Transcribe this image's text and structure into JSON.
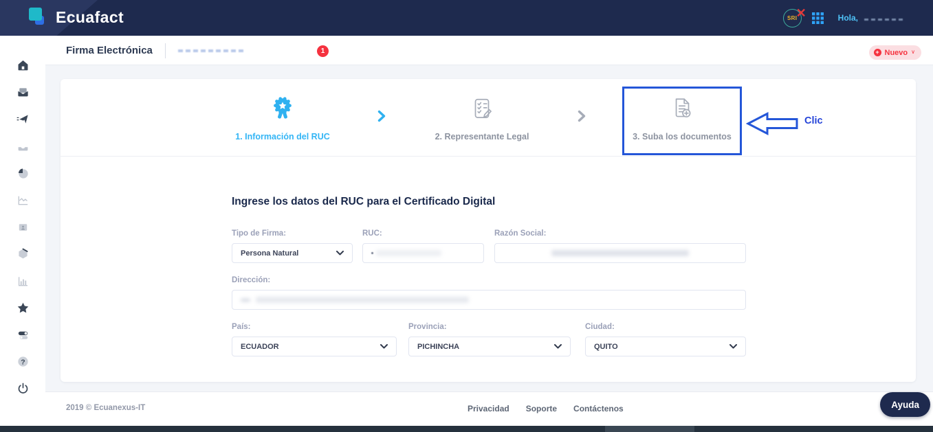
{
  "navbar": {
    "brand": "Ecuafact",
    "sri_label": "SRI",
    "greeting": "Hola,"
  },
  "breadcrumb": {
    "title": "Firma Electrónica",
    "badge_count": "1"
  },
  "toolbar": {
    "new_label": "Nuevo"
  },
  "sidebar": {
    "icons": [
      "home-icon",
      "mail-icon",
      "send-icon",
      "inbox-icon",
      "pie-chart-icon",
      "line-chart-icon",
      "folder-user-icon",
      "hexagon-icon",
      "bar-chart-icon",
      "star-icon",
      "toggles-icon",
      "help-icon",
      "power-icon"
    ]
  },
  "stepper": {
    "steps": [
      {
        "label": "1. Información del RUC",
        "state": "active"
      },
      {
        "label": "2. Representante Legal",
        "state": "idle"
      },
      {
        "label": "3. Suba los documentos",
        "state": "highlighted"
      }
    ],
    "annotation_text": "Clic"
  },
  "form": {
    "heading": "Ingrese los datos del RUC para el Certificado Digital",
    "fields": {
      "tipo_de_firma": {
        "label": "Tipo de Firma:",
        "value": "Persona Natural"
      },
      "ruc": {
        "label": "RUC:",
        "value": ""
      },
      "razon_social": {
        "label": "Razón Social:",
        "value": ""
      },
      "direccion": {
        "label": "Dirección:",
        "value": ""
      },
      "pais": {
        "label": "País:",
        "value": "ECUADOR"
      },
      "provincia": {
        "label": "Provincia:",
        "value": "PICHINCHA"
      },
      "ciudad": {
        "label": "Ciudad:",
        "value": "QUITO"
      }
    }
  },
  "footer": {
    "copyright": "2019 © Ecuanexus-IT",
    "links": [
      "Privacidad",
      "Soporte",
      "Contáctenos"
    ],
    "help_label": "Ayuda"
  },
  "colors": {
    "navbar": "#1e2a4e",
    "accent_blue": "#33b5f5",
    "annotation_blue": "#2456d8",
    "alert_red": "#f5323f",
    "pill_pink": "#fbdee2",
    "teal_logo": "#1fb9c9"
  }
}
